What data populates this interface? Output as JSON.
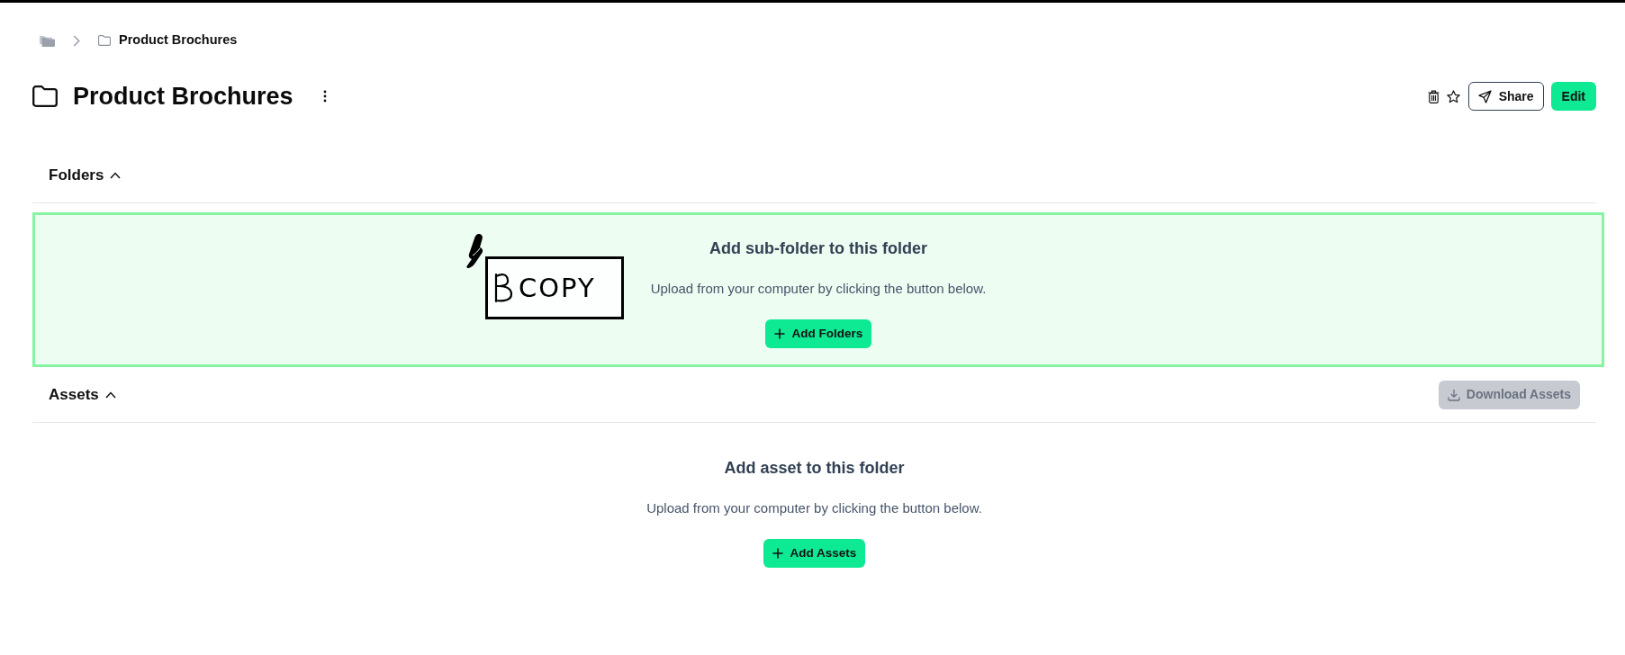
{
  "breadcrumb": {
    "current": "Product Brochures"
  },
  "header": {
    "title": "Product Brochures",
    "starred": false,
    "buttons": [
      {
        "kind": "outline",
        "label": "Share"
      },
      {
        "kind": "primary",
        "label": "Edit"
      }
    ]
  },
  "sections": [
    {
      "title": "Folders",
      "expanded": true,
      "drag_over": true,
      "heading": "Add sub-folder to this folder",
      "text": "Upload from your computer by clicking the button below.",
      "button": "Add Folders",
      "drag_cursor": {
        "label": "COPY"
      }
    },
    {
      "title": "Assets",
      "expanded": true,
      "drag_over": false,
      "download": {
        "label": "Download Assets",
        "disabled": true
      },
      "heading": "Add asset to this folder",
      "text": "Upload from your computer by clicking the button below.",
      "button": "Add Assets"
    }
  ]
}
